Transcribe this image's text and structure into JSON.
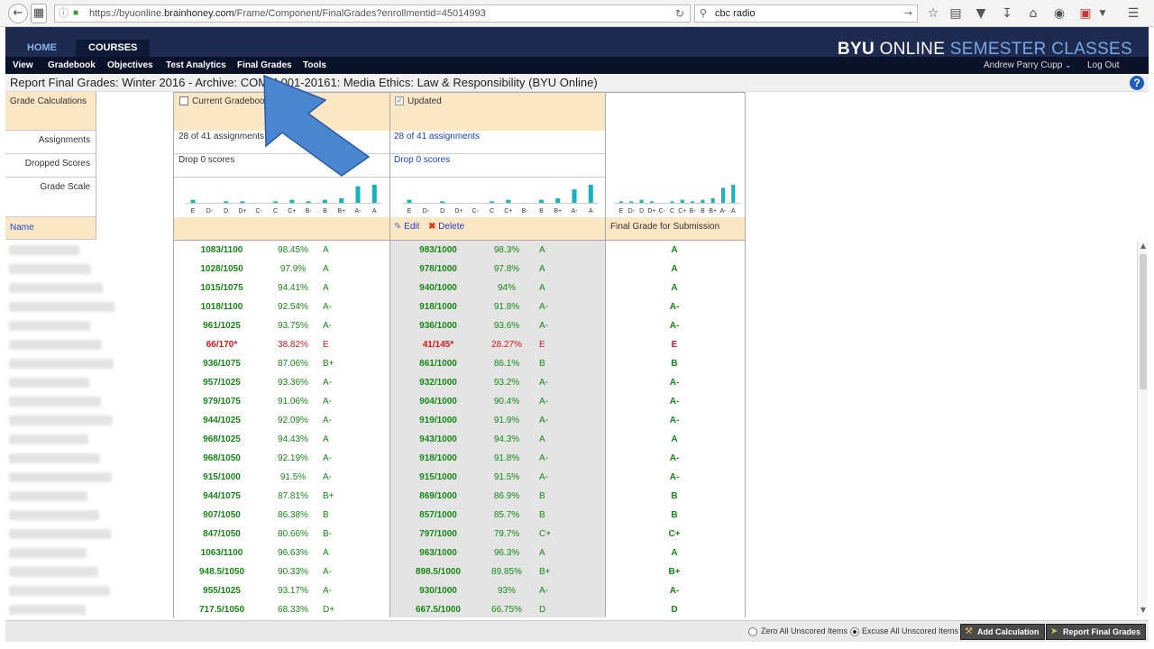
{
  "browser": {
    "url_prefix": "https://byuonline.",
    "url_domain": "brainhoney.com",
    "url_path": "/Frame/Component/FinalGrades?enrollmentid=45014993",
    "search_value": "cbc radio"
  },
  "header": {
    "tabs": [
      "HOME",
      "COURSES"
    ],
    "brand_1": "BYU",
    "brand_2": " ONLINE ",
    "brand_3": "SEMESTER CLASSES"
  },
  "menu": {
    "items": [
      "View",
      "Gradebook",
      "Objectives",
      "Test Analytics",
      "Final Grades",
      "Tools"
    ],
    "user": "Andrew Parry Cupp",
    "logout": "Log Out"
  },
  "page_title": "Report Final Grades: Winter 2016 - Archive: COMM 001-20161: Media Ethics: Law & Responsibility (BYU Online)",
  "left_panel": {
    "grade_calc": "Grade Calculations",
    "assignments": "Assignments",
    "dropped": "Dropped Scores",
    "scale": "Grade Scale",
    "name": "Name"
  },
  "current_col": {
    "header": "Current Gradebook",
    "assignments": "28 of 41 assignments",
    "dropped": "Drop 0 scores"
  },
  "updated_col": {
    "header": "Updated",
    "assignments": "28 of 41 assignments",
    "dropped": "Drop 0 scores",
    "edit": "Edit",
    "delete": "Delete"
  },
  "final_col": {
    "header": "Final Grade for Submission"
  },
  "chart_data": {
    "type": "bar",
    "categories": [
      "E",
      "D-",
      "D",
      "D+",
      "C-",
      "C",
      "C+",
      "B-",
      "B",
      "B+",
      "A-",
      "A"
    ],
    "series": [
      {
        "name": "Current Gradebook",
        "values": [
          2,
          0,
          1,
          1,
          0,
          1,
          2,
          1,
          2,
          3,
          11,
          12
        ]
      },
      {
        "name": "Updated",
        "values": [
          2,
          0,
          1,
          0,
          0,
          1,
          2,
          0,
          2,
          3,
          9,
          12
        ]
      },
      {
        "name": "Final Grade for Submission",
        "values": [
          1,
          1,
          2,
          1,
          0,
          1,
          2,
          1,
          2,
          3,
          10,
          12
        ]
      }
    ],
    "colors": {
      "bar": "#14b3c2"
    }
  },
  "rows": [
    {
      "c_pts": "1083/1100",
      "c_pct": "98.45%",
      "c_g": "A",
      "u_pts": "983/1000",
      "u_pct": "98.3%",
      "u_g": "A",
      "f": "A",
      "red": false
    },
    {
      "c_pts": "1028/1050",
      "c_pct": "97.9%",
      "c_g": "A",
      "u_pts": "978/1000",
      "u_pct": "97.8%",
      "u_g": "A",
      "f": "A",
      "red": false
    },
    {
      "c_pts": "1015/1075",
      "c_pct": "94.41%",
      "c_g": "A",
      "u_pts": "940/1000",
      "u_pct": "94%",
      "u_g": "A",
      "f": "A",
      "red": false
    },
    {
      "c_pts": "1018/1100",
      "c_pct": "92.54%",
      "c_g": "A-",
      "u_pts": "918/1000",
      "u_pct": "91.8%",
      "u_g": "A-",
      "f": "A-",
      "red": false
    },
    {
      "c_pts": "961/1025",
      "c_pct": "93.75%",
      "c_g": "A-",
      "u_pts": "936/1000",
      "u_pct": "93.6%",
      "u_g": "A-",
      "f": "A-",
      "red": false
    },
    {
      "c_pts": "66/170*",
      "c_pct": "38.82%",
      "c_g": "E",
      "u_pts": "41/145*",
      "u_pct": "28.27%",
      "u_g": "E",
      "f": "E",
      "red": true
    },
    {
      "c_pts": "936/1075",
      "c_pct": "87.06%",
      "c_g": "B+",
      "u_pts": "861/1000",
      "u_pct": "86.1%",
      "u_g": "B",
      "f": "B",
      "red": false
    },
    {
      "c_pts": "957/1025",
      "c_pct": "93.36%",
      "c_g": "A-",
      "u_pts": "932/1000",
      "u_pct": "93.2%",
      "u_g": "A-",
      "f": "A-",
      "red": false
    },
    {
      "c_pts": "979/1075",
      "c_pct": "91.06%",
      "c_g": "A-",
      "u_pts": "904/1000",
      "u_pct": "90.4%",
      "u_g": "A-",
      "f": "A-",
      "red": false
    },
    {
      "c_pts": "944/1025",
      "c_pct": "92.09%",
      "c_g": "A-",
      "u_pts": "919/1000",
      "u_pct": "91.9%",
      "u_g": "A-",
      "f": "A-",
      "red": false
    },
    {
      "c_pts": "968/1025",
      "c_pct": "94.43%",
      "c_g": "A",
      "u_pts": "943/1000",
      "u_pct": "94.3%",
      "u_g": "A",
      "f": "A",
      "red": false
    },
    {
      "c_pts": "968/1050",
      "c_pct": "92.19%",
      "c_g": "A-",
      "u_pts": "918/1000",
      "u_pct": "91.8%",
      "u_g": "A-",
      "f": "A-",
      "red": false
    },
    {
      "c_pts": "915/1000",
      "c_pct": "91.5%",
      "c_g": "A-",
      "u_pts": "915/1000",
      "u_pct": "91.5%",
      "u_g": "A-",
      "f": "A-",
      "red": false
    },
    {
      "c_pts": "944/1075",
      "c_pct": "87.81%",
      "c_g": "B+",
      "u_pts": "869/1000",
      "u_pct": "86.9%",
      "u_g": "B",
      "f": "B",
      "red": false
    },
    {
      "c_pts": "907/1050",
      "c_pct": "86.38%",
      "c_g": "B",
      "u_pts": "857/1000",
      "u_pct": "85.7%",
      "u_g": "B",
      "f": "B",
      "red": false
    },
    {
      "c_pts": "847/1050",
      "c_pct": "80.66%",
      "c_g": "B-",
      "u_pts": "797/1000",
      "u_pct": "79.7%",
      "u_g": "C+",
      "f": "C+",
      "red": false
    },
    {
      "c_pts": "1063/1100",
      "c_pct": "96.63%",
      "c_g": "A",
      "u_pts": "963/1000",
      "u_pct": "96.3%",
      "u_g": "A",
      "f": "A",
      "red": false
    },
    {
      "c_pts": "948.5/1050",
      "c_pct": "90.33%",
      "c_g": "A-",
      "u_pts": "898.5/1000",
      "u_pct": "89.85%",
      "u_g": "B+",
      "f": "B+",
      "red": false
    },
    {
      "c_pts": "955/1025",
      "c_pct": "93.17%",
      "c_g": "A-",
      "u_pts": "930/1000",
      "u_pct": "93%",
      "u_g": "A-",
      "f": "A-",
      "red": false
    },
    {
      "c_pts": "717.5/1050",
      "c_pct": "68.33%",
      "c_g": "D+",
      "u_pts": "667.5/1000",
      "u_pct": "66.75%",
      "u_g": "D",
      "f": "D",
      "red": false
    }
  ],
  "footer": {
    "zero_label": "Zero All Unscored Items",
    "excuse_label": "Excuse All Unscored Items",
    "add_calc": "Add Calculation",
    "report": "Report Final Grades"
  }
}
